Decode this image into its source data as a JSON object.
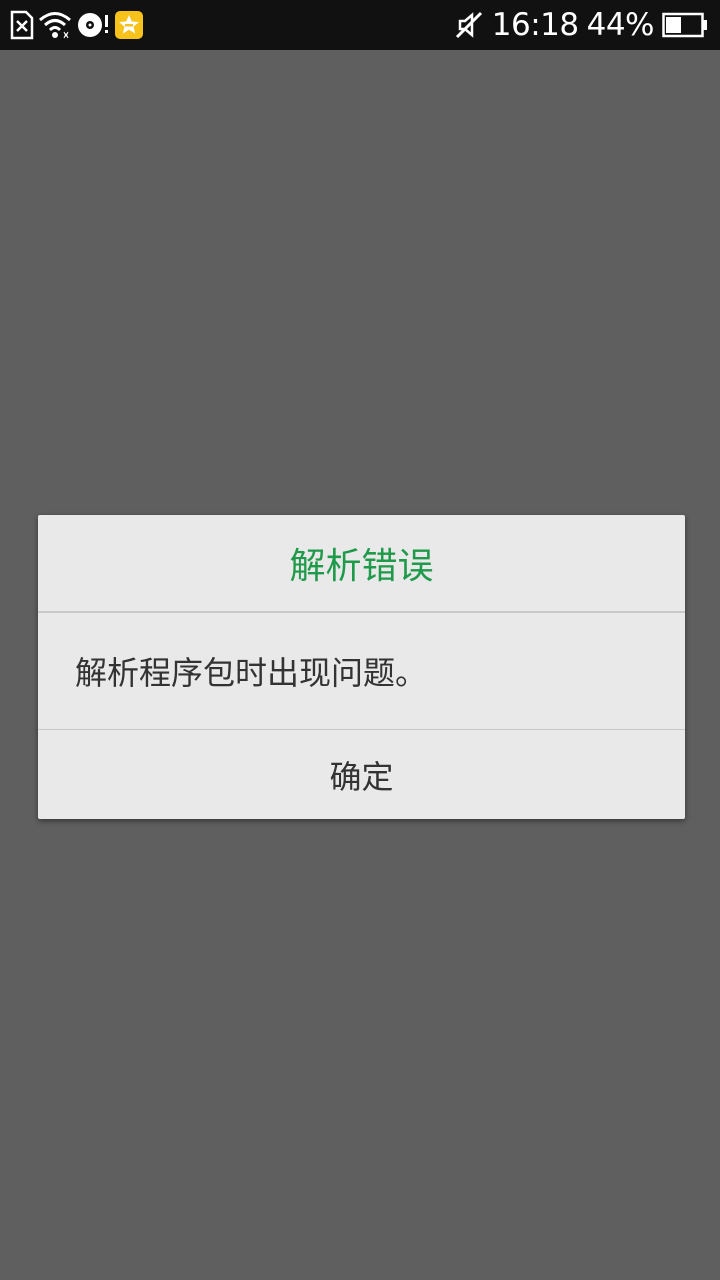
{
  "status_bar": {
    "time": "16:18",
    "battery_percent": "44%",
    "battery_level": 0.44,
    "left_icons": [
      "sim-error-icon",
      "wifi-icon",
      "sync-alert-icon",
      "qq-icon"
    ],
    "right_icons": [
      "mute-icon",
      "battery-icon"
    ]
  },
  "dialog": {
    "title": "解析错误",
    "message": "解析程序包时出现问题。",
    "ok_label": "确定"
  },
  "colors": {
    "accent": "#1f9a4b",
    "backdrop": "#5f5f5f",
    "dialog_bg": "#e9e9e9",
    "status_bar": "#111111",
    "qq_yellow": "#f7c21b"
  }
}
